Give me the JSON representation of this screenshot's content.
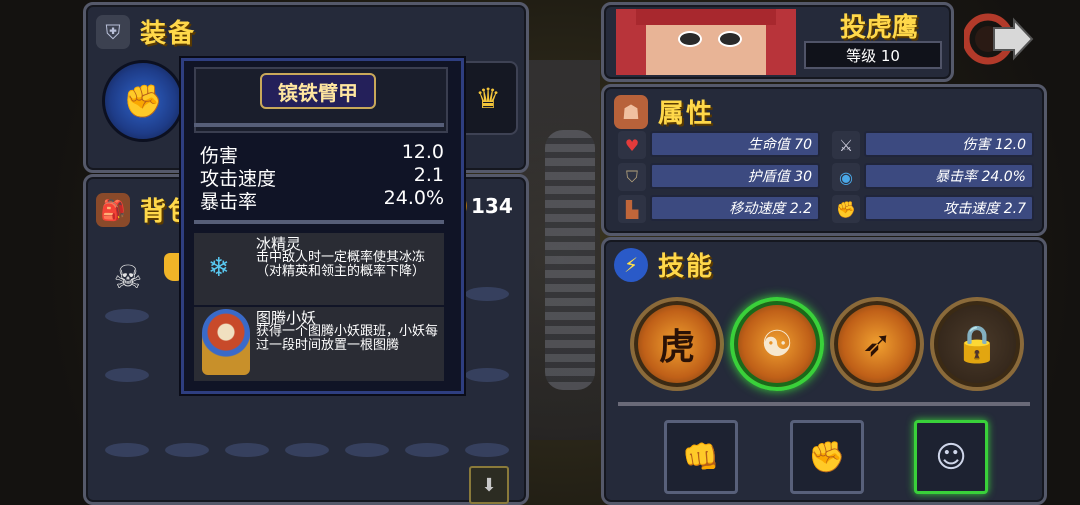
{
  "equipment": {
    "title": "装备"
  },
  "backpack": {
    "title": "背包",
    "gold": "134"
  },
  "tooltip": {
    "item_name": "镔铁臂甲",
    "stats": [
      {
        "label": "伤害",
        "value": "12.0"
      },
      {
        "label": "攻击速度",
        "value": "2.1"
      },
      {
        "label": "暴击率",
        "value": "24.0%"
      }
    ],
    "effects": [
      {
        "title": "冰精灵",
        "desc": "击中敌人时一定概率使其冰冻（对精英和领主的概率下降）"
      },
      {
        "title": "图腾小妖",
        "desc": "获得一个图腾小妖跟班，小妖每过一段时间放置一根图腾"
      }
    ]
  },
  "character": {
    "name": "投虎鹰",
    "level_label": "等级 10"
  },
  "attributes": {
    "title": "属性",
    "items": [
      {
        "label": "生命值 70",
        "icon": "heart-icon",
        "color": "#e33b3b"
      },
      {
        "label": "伤害 12.0",
        "icon": "sword-icon",
        "color": "#c8c8d8"
      },
      {
        "label": "护盾值 30",
        "icon": "shield-icon",
        "color": "#b6a47e"
      },
      {
        "label": "暴击率 24.0%",
        "icon": "eye-icon",
        "color": "#4aa8e8"
      },
      {
        "label": "移动速度 2.2",
        "icon": "boot-icon",
        "color": "#c0663a"
      },
      {
        "label": "攻击速度 2.7",
        "icon": "fist-icon",
        "color": "#e07a3a"
      }
    ]
  },
  "skills": {
    "title": "技能",
    "first_skill_glyph": "虎"
  },
  "colors": {
    "gold": "#ffd84a",
    "panel": "#252a3a",
    "accent_green": "#39d13a",
    "tooltip_border": "#2e3e80"
  }
}
